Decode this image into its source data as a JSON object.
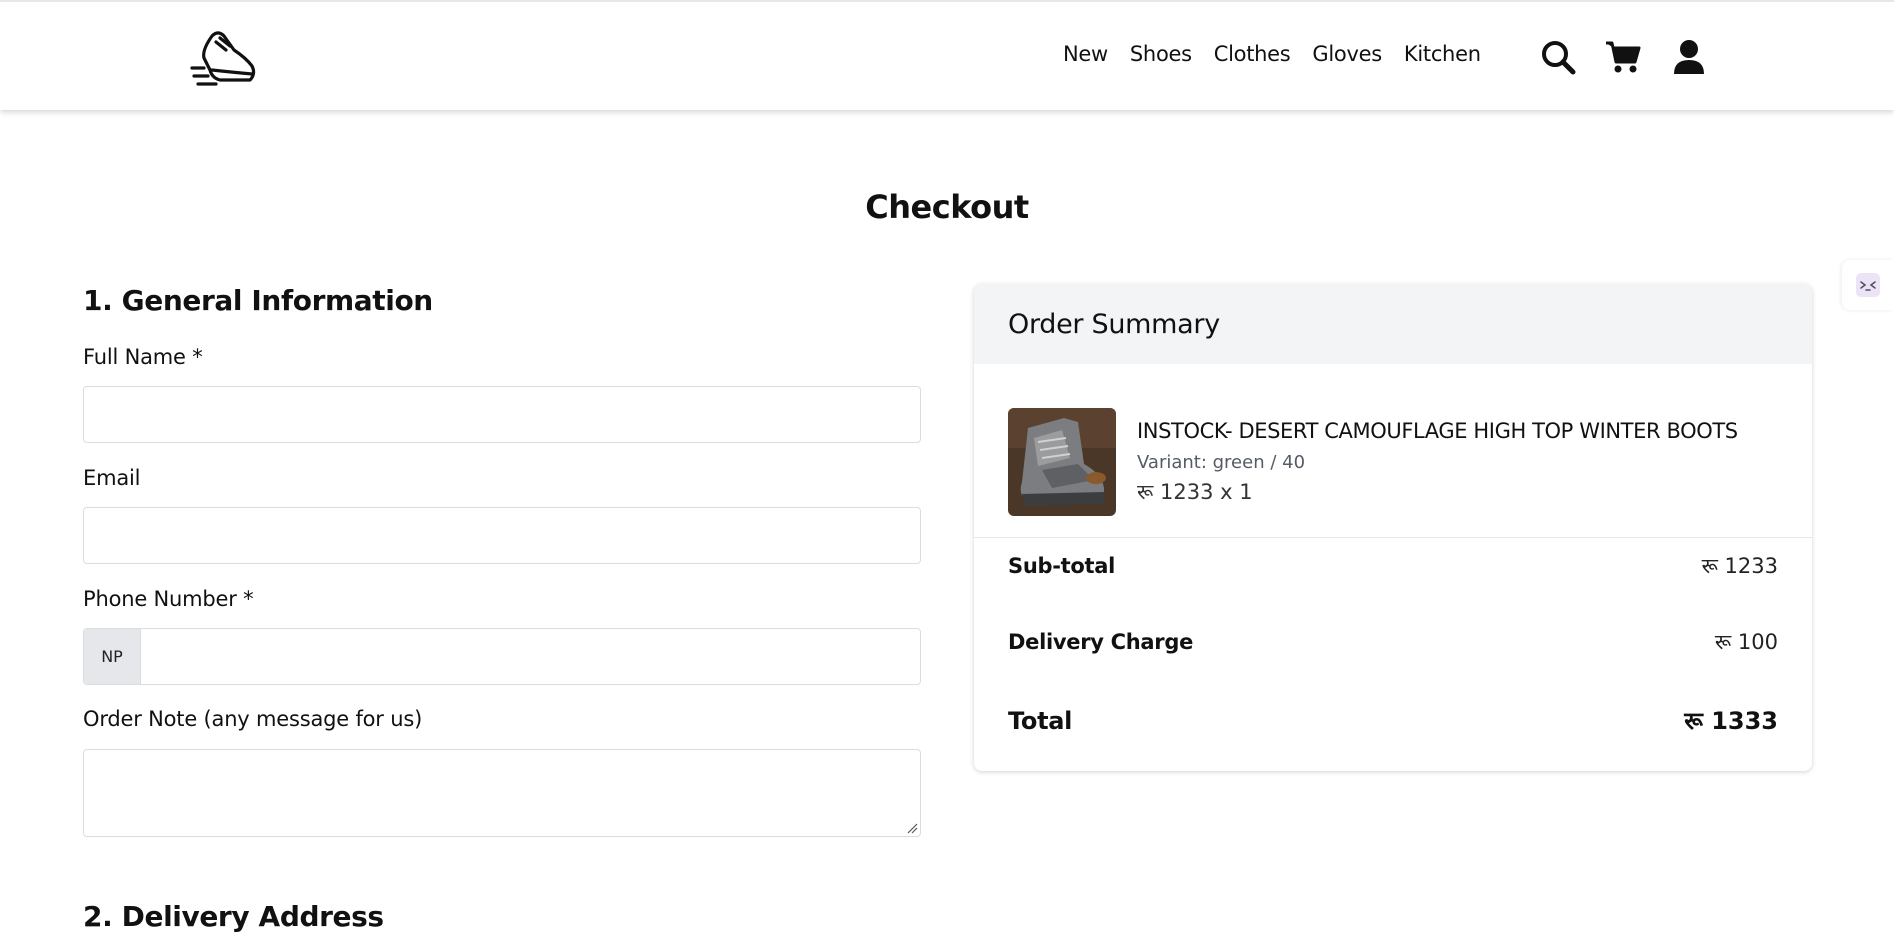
{
  "nav": {
    "items": [
      {
        "label": "New"
      },
      {
        "label": "Shoes"
      },
      {
        "label": "Clothes"
      },
      {
        "label": "Gloves"
      },
      {
        "label": "Kitchen"
      }
    ],
    "icons": [
      "search-icon",
      "cart-icon",
      "user-icon"
    ]
  },
  "page": {
    "title": "Checkout"
  },
  "general": {
    "section_title": "1. General Information",
    "full_name_label": "Full Name *",
    "full_name_value": "",
    "email_label": "Email",
    "email_value": "",
    "phone_label": "Phone Number *",
    "phone_prefix": "NP",
    "phone_value": "",
    "note_label": "Order Note (any message for us)",
    "note_value": ""
  },
  "delivery": {
    "section_title": "2. Delivery Address"
  },
  "summary": {
    "title": "Order Summary",
    "item": {
      "name": "INSTOCK- DESERT CAMOUFLAGE HIGH TOP WINTER BOOTS",
      "variant": "Variant: green / 40",
      "price_line": "रू 1233 x 1"
    },
    "subtotal_label": "Sub-total",
    "subtotal_value": "रू 1233",
    "delivery_label": "Delivery Charge",
    "delivery_value": "रू 100",
    "total_label": "Total",
    "total_value": "रू 1333"
  },
  "colors": {
    "summary_header_bg": "#f3f4f6",
    "prefix_bg": "#e5e7eb",
    "border": "#d9dce1"
  }
}
